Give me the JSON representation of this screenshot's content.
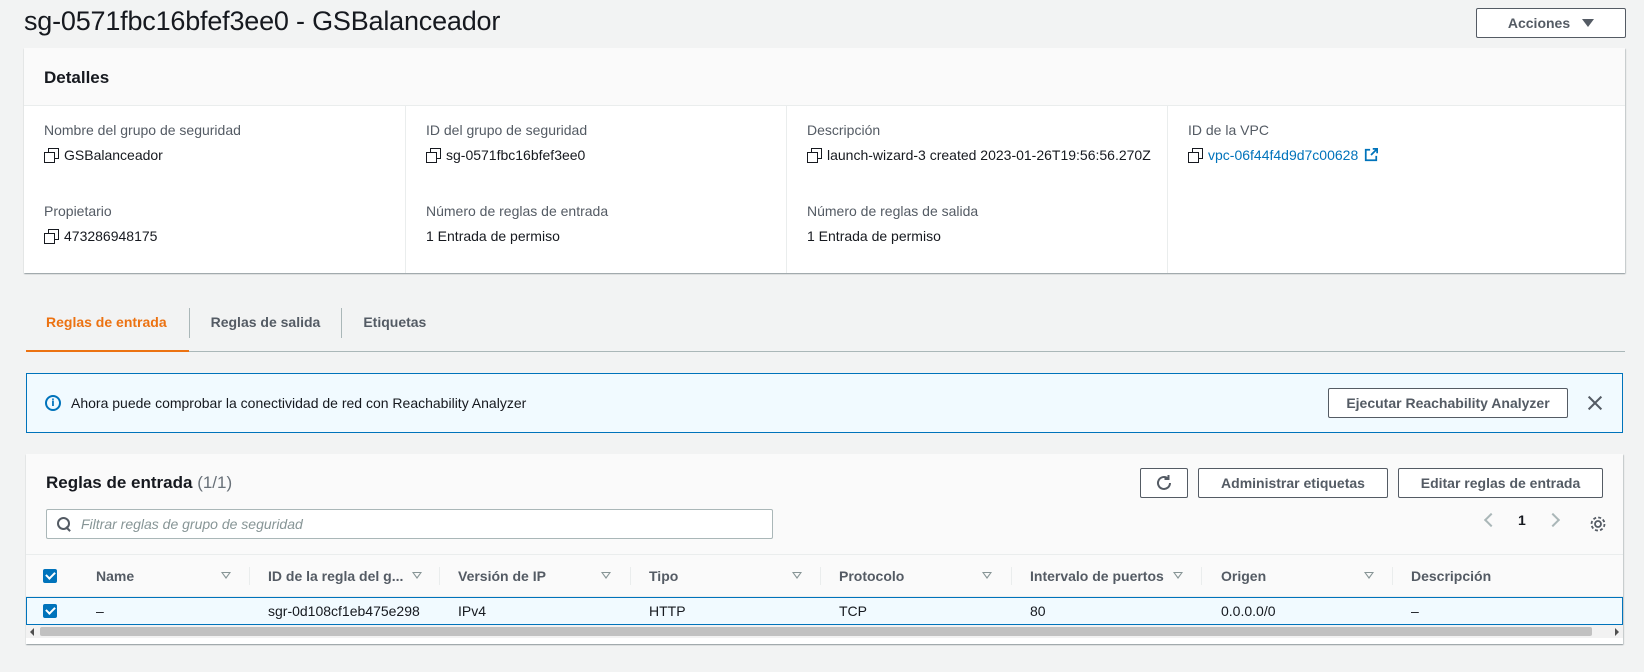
{
  "page": {
    "title": "sg-0571fbc16bfef3ee0 - GSBalanceador",
    "actions_label": "Acciones"
  },
  "details": {
    "header": "Detalles",
    "fields": [
      {
        "label": "Nombre del grupo de seguridad",
        "value": "GSBalanceador",
        "copy": true
      },
      {
        "label": "ID del grupo de seguridad",
        "value": "sg-0571fbc16bfef3ee0",
        "copy": true
      },
      {
        "label": "Descripción",
        "value": "launch-wizard-3 created 2023-01-26T19:56:56.270Z",
        "copy": true
      },
      {
        "label": "ID de la VPC",
        "value": "vpc-06f44f4d9d7c00628",
        "copy": true,
        "link": true
      },
      {
        "label": "Propietario",
        "value": "473286948175",
        "copy": true
      },
      {
        "label": "Número de reglas de entrada",
        "value": "1 Entrada de permiso"
      },
      {
        "label": "Número de reglas de salida",
        "value": "1 Entrada de permiso"
      }
    ]
  },
  "tabs": [
    {
      "label": "Reglas de entrada",
      "active": true
    },
    {
      "label": "Reglas de salida",
      "active": false
    },
    {
      "label": "Etiquetas",
      "active": false
    }
  ],
  "alert": {
    "text": "Ahora puede comprobar la conectividad de red con Reachability Analyzer",
    "button_label": "Ejecutar Reachability Analyzer"
  },
  "rules": {
    "title": "Reglas de entrada",
    "count": "(1/1)",
    "manage_tags_label": "Administrar etiquetas",
    "edit_rules_label": "Editar reglas de entrada",
    "search_placeholder": "Filtrar reglas de grupo de seguridad",
    "page_number": "1",
    "columns": [
      "Name",
      "ID de la regla del g...",
      "Versión de IP",
      "Tipo",
      "Protocolo",
      "Intervalo de puertos",
      "Origen",
      "Descripción"
    ],
    "rows": [
      {
        "name": "–",
        "rule_id": "sgr-0d108cf1eb475e298",
        "ip_version": "IPv4",
        "type": "HTTP",
        "protocol": "TCP",
        "port_range": "80",
        "source": "0.0.0.0/0",
        "description": "–",
        "selected": true
      }
    ]
  },
  "colors": {
    "accent": "#ec7211",
    "link": "#0073bb",
    "info_bg": "#f1faff"
  }
}
